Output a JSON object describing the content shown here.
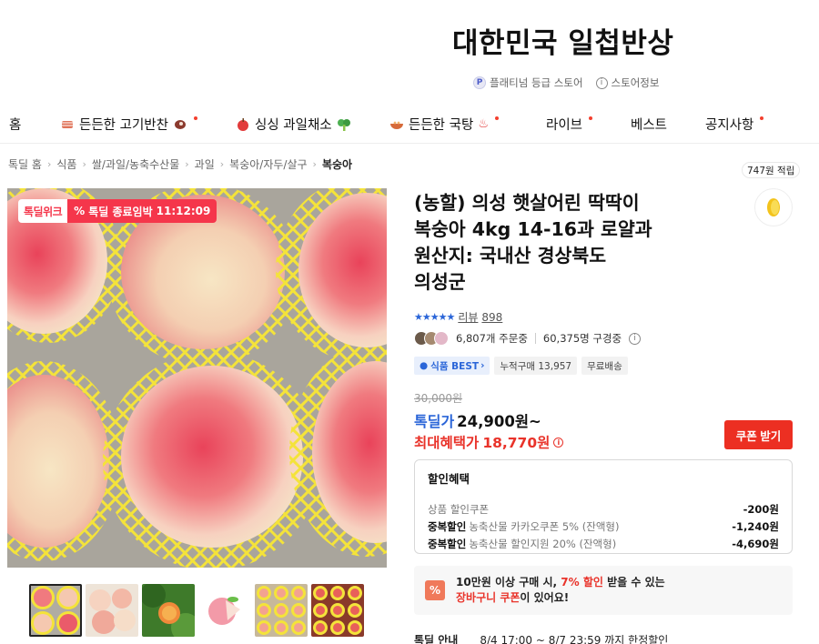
{
  "store": {
    "title": "대한민국 일첩반상",
    "grade": "플래티넘 등급 스토어",
    "info": "스토어정보"
  },
  "nav": {
    "items": [
      {
        "label": "홈",
        "new": false
      },
      {
        "label": "든든한 고기반찬",
        "new": true
      },
      {
        "label": "싱싱 과일채소",
        "new": false
      },
      {
        "label": "든든한 국탕",
        "new": true
      },
      {
        "label": "라이브",
        "new": true
      },
      {
        "label": "베스트",
        "new": false
      },
      {
        "label": "공지사항",
        "new": true
      }
    ]
  },
  "breadcrumb": [
    "톡딜 홈",
    "식품",
    "쌀/과일/농축수산물",
    "과일",
    "복숭아/자두/살구",
    "복숭아"
  ],
  "image": {
    "badge_brand": "톡딜위크",
    "badge_timer_prefix": "톡딜 종료임박",
    "badge_timer": "11:12:09"
  },
  "product": {
    "title_line1": "(농할) 의성 햇살어린 딱딱이",
    "title_line2": "복숭아 4kg 14-16과 로얄과",
    "title_line3": "원산지: 국내산 경상북도",
    "title_line4": "의성군",
    "stars": "★★★★★",
    "review_label": "리뷰",
    "review_count": "898",
    "orders": "6,807개 주문중",
    "viewers": "60,375명 구경중",
    "tags": [
      "식품 BEST",
      "누적구매 13,957",
      "무료배송"
    ],
    "original_price": "30,000원",
    "deal_label": "톡딜가",
    "deal_price": "24,900원~",
    "max_label": "최대혜택가",
    "max_price": "18,770원",
    "coupon_button": "쿠폰 받기"
  },
  "discount": {
    "header": "할인혜택",
    "rows": [
      {
        "tag": "",
        "desc": "상품 할인쿠폰",
        "amount": "-200원"
      },
      {
        "tag": "중복할인",
        "desc": "농축산물 카카오쿠폰 5% (잔액형)",
        "amount": "-1,240원"
      },
      {
        "tag": "중복할인",
        "desc": "농축산물 할인지원 20% (잔액형)",
        "amount": "-4,690원"
      }
    ]
  },
  "cart_banner": {
    "icon": "%",
    "line1_a": "10만원 이상 구매 시,",
    "line1_b": "7% 할인",
    "line1_c": "받을 수 있는",
    "line2_a": "장바구니 쿠폰",
    "line2_b": "이 있어요!"
  },
  "deal_info": {
    "label": "톡딜 안내",
    "period": "8/4 17:00 ~ 8/7 23:59 까지 한정할인"
  },
  "points": {
    "label": "747원 적립"
  },
  "colors": {
    "accent_blue": "#2a65d8",
    "accent_red": "#e9332a",
    "deal_pink": "#f5364b"
  }
}
